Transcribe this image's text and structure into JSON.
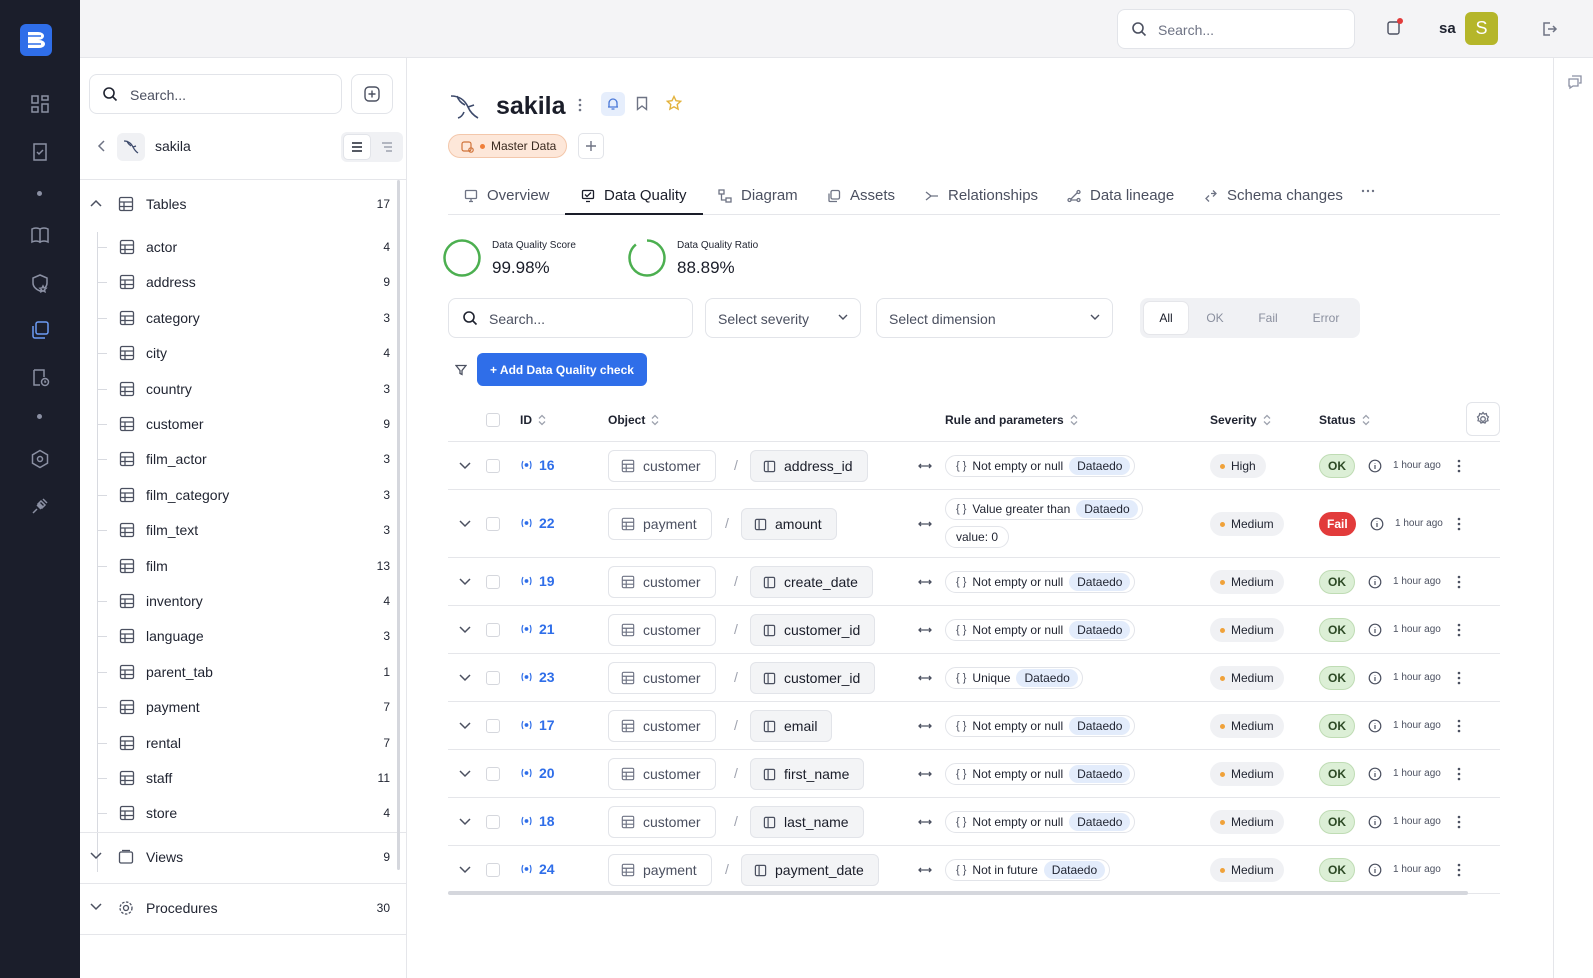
{
  "topbar": {
    "search_placeholder": "Search...",
    "user_name": "sa",
    "avatar_initial": "S"
  },
  "side": {
    "search_placeholder": "Search...",
    "breadcrumb": "sakila",
    "groups": [
      {
        "label": "Tables",
        "count": "17"
      },
      {
        "label": "Views",
        "count": "9"
      },
      {
        "label": "Procedures",
        "count": "30"
      }
    ],
    "tables": [
      {
        "name": "actor",
        "count": "4"
      },
      {
        "name": "address",
        "count": "9"
      },
      {
        "name": "category",
        "count": "3"
      },
      {
        "name": "city",
        "count": "4"
      },
      {
        "name": "country",
        "count": "3"
      },
      {
        "name": "customer",
        "count": "9"
      },
      {
        "name": "film_actor",
        "count": "3"
      },
      {
        "name": "film_category",
        "count": "3"
      },
      {
        "name": "film_text",
        "count": "3"
      },
      {
        "name": "film",
        "count": "13"
      },
      {
        "name": "inventory",
        "count": "4"
      },
      {
        "name": "language",
        "count": "3"
      },
      {
        "name": "parent_tab",
        "count": "1"
      },
      {
        "name": "payment",
        "count": "7"
      },
      {
        "name": "rental",
        "count": "7"
      },
      {
        "name": "staff",
        "count": "11"
      },
      {
        "name": "store",
        "count": "4"
      }
    ]
  },
  "main": {
    "title": "sakila",
    "tag": "Master Data",
    "tabs": [
      "Overview",
      "Data Quality",
      "Diagram",
      "Assets",
      "Relationships",
      "Data lineage",
      "Schema changes"
    ],
    "metrics": [
      {
        "label": "Data Quality Score",
        "value": "99.98%"
      },
      {
        "label": "Data Quality Ratio",
        "value": "88.89%"
      }
    ],
    "filters": {
      "search_placeholder": "Search...",
      "severity_placeholder": "Select severity",
      "dimension_placeholder": "Select dimension",
      "status_options": [
        "All",
        "OK",
        "Fail",
        "Error"
      ],
      "active_status": "All"
    },
    "add_button": "+ Add Data Quality check"
  },
  "table": {
    "columns": {
      "id": "ID",
      "object": "Object",
      "rule": "Rule and parameters",
      "severity": "Severity",
      "status": "Status"
    },
    "rows": [
      {
        "id": "16",
        "table": "customer",
        "column": "address_id",
        "rule": "Not empty or null",
        "source": "Dataedo",
        "param": "",
        "severity": "High",
        "status": "OK",
        "time": "1 hour ago"
      },
      {
        "id": "22",
        "table": "payment",
        "column": "amount",
        "rule": "Value greater than",
        "source": "Dataedo",
        "param": "value: 0",
        "severity": "Medium",
        "status": "Fail",
        "time": "1 hour ago"
      },
      {
        "id": "19",
        "table": "customer",
        "column": "create_date",
        "rule": "Not empty or null",
        "source": "Dataedo",
        "param": "",
        "severity": "Medium",
        "status": "OK",
        "time": "1 hour ago"
      },
      {
        "id": "21",
        "table": "customer",
        "column": "customer_id",
        "rule": "Not empty or null",
        "source": "Dataedo",
        "param": "",
        "severity": "Medium",
        "status": "OK",
        "time": "1 hour ago"
      },
      {
        "id": "23",
        "table": "customer",
        "column": "customer_id",
        "rule": "Unique",
        "source": "Dataedo",
        "param": "",
        "severity": "Medium",
        "status": "OK",
        "time": "1 hour ago"
      },
      {
        "id": "17",
        "table": "customer",
        "column": "email",
        "rule": "Not empty or null",
        "source": "Dataedo",
        "param": "",
        "severity": "Medium",
        "status": "OK",
        "time": "1 hour ago"
      },
      {
        "id": "20",
        "table": "customer",
        "column": "first_name",
        "rule": "Not empty or null",
        "source": "Dataedo",
        "param": "",
        "severity": "Medium",
        "status": "OK",
        "time": "1 hour ago"
      },
      {
        "id": "18",
        "table": "customer",
        "column": "last_name",
        "rule": "Not empty or null",
        "source": "Dataedo",
        "param": "",
        "severity": "Medium",
        "status": "OK",
        "time": "1 hour ago"
      },
      {
        "id": "24",
        "table": "payment",
        "column": "payment_date",
        "rule": "Not in future",
        "source": "Dataedo",
        "param": "",
        "severity": "Medium",
        "status": "OK",
        "time": "1 hour ago"
      }
    ]
  },
  "colors": {
    "accent": "#2f6ee9",
    "rail": "#1b1e2b",
    "fail": "#e23b3b",
    "ok_bg": "#dcefd6",
    "severity_dot": "#f0a23a",
    "ring": "#4caf50"
  }
}
